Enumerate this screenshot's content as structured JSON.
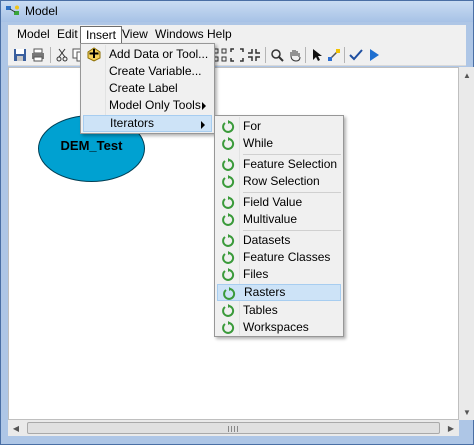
{
  "window": {
    "title": "Model"
  },
  "menubar": {
    "items": [
      {
        "label": "Model"
      },
      {
        "label": "Edit"
      },
      {
        "label": "Insert"
      },
      {
        "label": "View"
      },
      {
        "label": "Windows"
      },
      {
        "label": "Help"
      }
    ]
  },
  "insert_menu": {
    "items": [
      {
        "label": "Add Data or Tool...",
        "icon": "add-data-icon"
      },
      {
        "label": "Create Variable..."
      },
      {
        "label": "Create Label"
      },
      {
        "label": "Model Only Tools",
        "submenu": true
      },
      {
        "label": "Iterators",
        "submenu": true,
        "highlighted": true
      }
    ]
  },
  "iterators_menu": {
    "items": [
      {
        "label": "For"
      },
      {
        "label": "While"
      },
      {
        "label": "Feature Selection"
      },
      {
        "label": "Row Selection"
      },
      {
        "label": "Field Value"
      },
      {
        "label": "Multivalue"
      },
      {
        "label": "Datasets"
      },
      {
        "label": "Feature Classes"
      },
      {
        "label": "Files"
      },
      {
        "label": "Rasters",
        "highlighted": true
      },
      {
        "label": "Tables"
      },
      {
        "label": "Workspaces"
      }
    ],
    "icon": "iterator-icon",
    "icon_color": "#3a9a3a"
  },
  "model": {
    "element_label": "DEM_Test",
    "element_color": "#00a1d1"
  },
  "colors": {
    "highlight": "#cde3f7",
    "menu_bg": "#f0f0f0",
    "frame": "#aec6e6"
  }
}
